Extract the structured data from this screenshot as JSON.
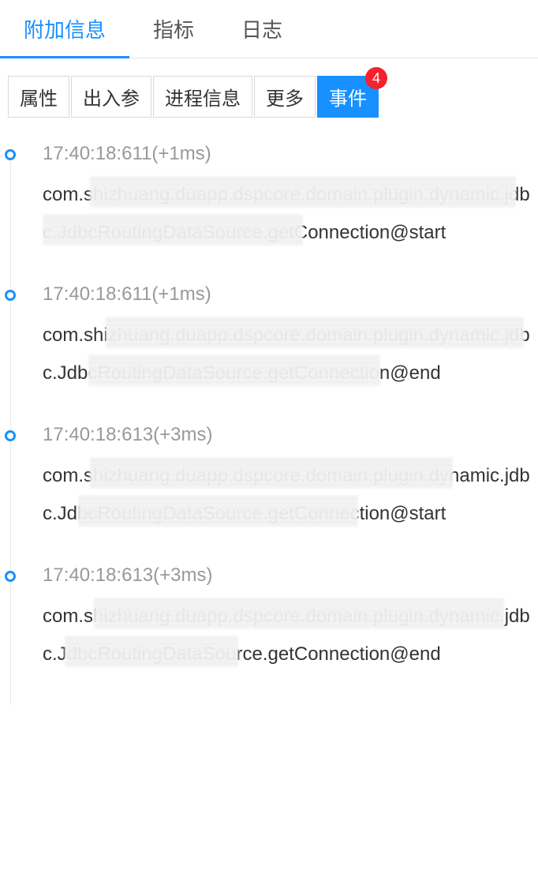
{
  "topTabs": {
    "items": [
      {
        "label": "附加信息",
        "active": true
      },
      {
        "label": "指标",
        "active": false
      },
      {
        "label": "日志",
        "active": false
      }
    ]
  },
  "filterBar": {
    "items": [
      {
        "label": "属性",
        "active": false
      },
      {
        "label": "出入参",
        "active": false
      },
      {
        "label": "进程信息",
        "active": false
      },
      {
        "label": "更多",
        "active": false
      },
      {
        "label": "事件",
        "active": true,
        "badge": "4"
      }
    ]
  },
  "events": [
    {
      "time": "17:40:18:611(+1ms)",
      "text": "com.shizhuang.duapp.dspcore.domain.plugin.dynamic.jdbc.JdbcRoutingDataSource.getConnection@start"
    },
    {
      "time": "17:40:18:611(+1ms)",
      "text": "com.shizhuang.duapp.dspcore.domain.plugin.dynamic.jdbc.JdbcRoutingDataSource.getConnection@end"
    },
    {
      "time": "17:40:18:613(+3ms)",
      "text": "com.shizhuang.duapp.dspcore.domain.plugin.dynamic.jdbc.JdbcRoutingDataSource.getConnection@start"
    },
    {
      "time": "17:40:18:613(+3ms)",
      "text": "com.shizhuang.duapp.dspcore.domain.plugin.dynamic.jdbc.JdbcRoutingDataSource.getConnection@end"
    }
  ]
}
